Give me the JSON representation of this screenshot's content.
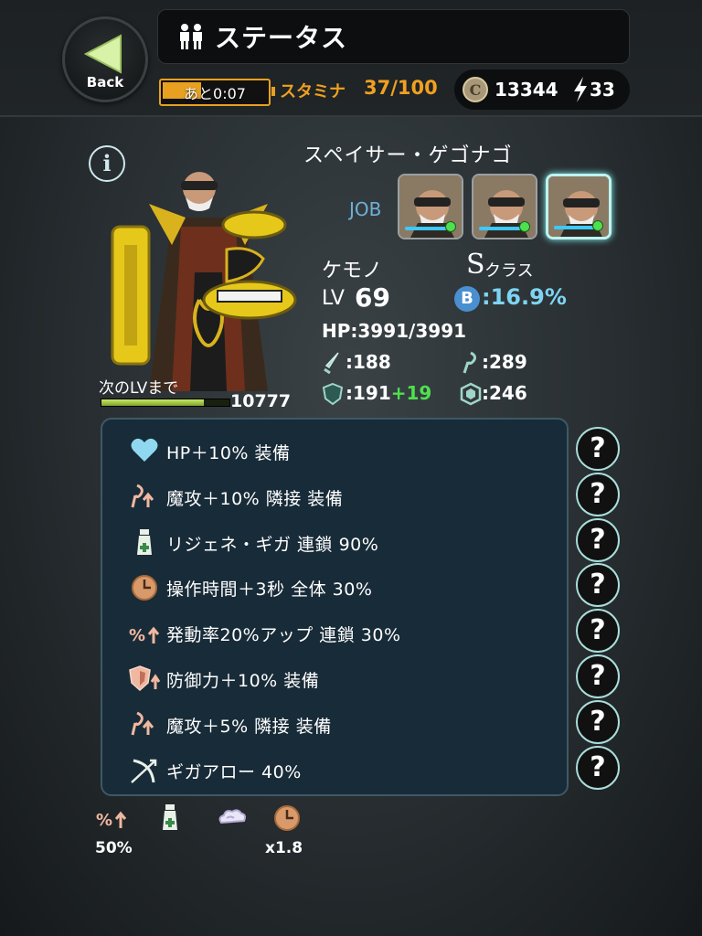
{
  "header": {
    "back_label": "Back",
    "title": "ステータス",
    "stamina_timer": "あと0:07",
    "stamina_fill_fraction": 0.37,
    "stamina_label": "スタミナ",
    "stamina_value": "37/100",
    "coins": "13344",
    "energy": "33"
  },
  "character": {
    "name": "スペイサー・ゲゴナゴ",
    "job_label": "JOB",
    "job_count": 3,
    "active_job": 3,
    "race": "ケモノ",
    "class_letter": "S",
    "class_text": "クラス",
    "lv_label": "LV",
    "level": "69",
    "b_badge": "B",
    "b_rate": ":16.9%",
    "hp": "HP:3991/3991",
    "attack": ":188",
    "magic_attack": ":289",
    "defense": ":191",
    "defense_bonus": "+19",
    "magic_defense": ":246",
    "next_lv_label": "次のLVまで",
    "exp_fill_fraction": 0.8,
    "exp_remaining": "10777"
  },
  "skills": [
    {
      "icon": "heart-icon",
      "text": "HP＋10% 装備"
    },
    {
      "icon": "magic-attack-up-icon",
      "text": "魔攻＋10% 隣接 装備"
    },
    {
      "icon": "potion-icon",
      "text": "リジェネ・ギガ 連鎖 90%"
    },
    {
      "icon": "clock-icon",
      "text": "操作時間＋3秒 全体 30%"
    },
    {
      "icon": "percent-up-icon",
      "text": "発動率20%アップ 連鎖 30%"
    },
    {
      "icon": "shield-up-icon",
      "text": "防御力＋10% 装備"
    },
    {
      "icon": "magic-attack-up-icon",
      "text": "魔攻＋5% 隣接 装備"
    },
    {
      "icon": "bow-icon",
      "text": "ギガアロー 40%"
    }
  ],
  "help_button_label": "?",
  "bottom_summary": [
    {
      "icon": "percent-up-icon",
      "value": "50%"
    },
    {
      "icon": "potion-icon",
      "value": ""
    },
    {
      "icon": "cloud-icon",
      "value": ""
    },
    {
      "icon": "clock-icon",
      "value": "x1.8"
    }
  ],
  "colors": {
    "accent_orange": "#f0a020",
    "b_rate_blue": "#7ed4f2",
    "job_blue": "#6fb0d8",
    "bonus_green": "#4ee04e",
    "panel_bg": "#182b38"
  }
}
